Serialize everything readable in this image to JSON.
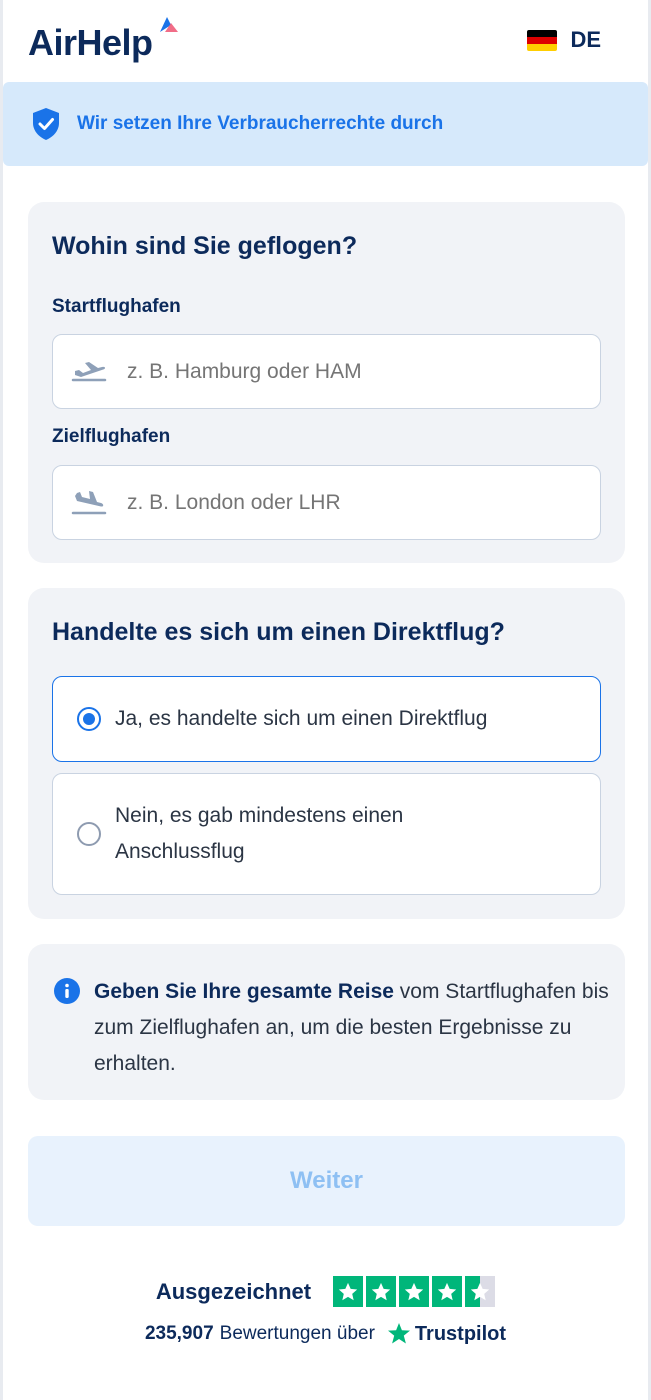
{
  "header": {
    "logo_text": "AirHelp",
    "language_code": "DE",
    "flag_colors": [
      "#000000",
      "#dd0000",
      "#ffce00"
    ]
  },
  "banner": {
    "text": "Wir setzen Ihre Verbraucherrechte durch",
    "icon": "shield-check-icon"
  },
  "route": {
    "title": "Wohin sind Sie geflogen?",
    "departure_label": "Startflughafen",
    "departure_placeholder": "z. B. Hamburg oder HAM",
    "departure_value": "",
    "arrival_label": "Zielflughafen",
    "arrival_placeholder": "z. B. London oder LHR",
    "arrival_value": ""
  },
  "direct": {
    "title": "Handelte es sich um einen Direktflug?",
    "options": [
      {
        "label": "Ja, es handelte sich um einen Direktflug",
        "selected": true
      },
      {
        "label": "Nein, es gab mindestens einen Anschlussflug",
        "selected": false
      }
    ]
  },
  "info": {
    "bold": "Geben Sie Ihre gesamte Reise",
    "rest": " vom Startflughafen bis zum Zielflughafen an, um die besten Ergebnisse zu erhalten.",
    "icon": "info-icon"
  },
  "continue_button": "Weiter",
  "trustpilot": {
    "rating_label": "Ausgezeichnet",
    "stars": 4.5,
    "review_count": "235,907",
    "reviews_text": "Bewertungen über",
    "brand": "Trustpilot",
    "star_color": "#00b67a"
  },
  "colors": {
    "primary": "#1a73e8",
    "navy": "#0c2a5b",
    "banner_bg": "#d6e9fb",
    "card_bg": "#f1f3f7"
  }
}
